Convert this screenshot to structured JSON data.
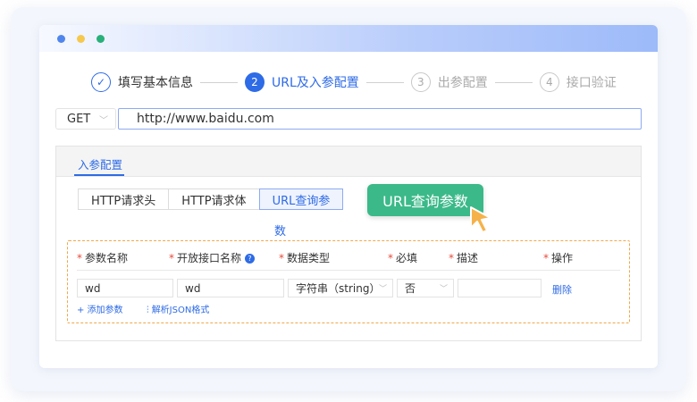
{
  "steps": [
    {
      "num": "✓",
      "label": "填写基本信息",
      "state": "done"
    },
    {
      "num": "2",
      "label": "URL及入参配置",
      "state": "active"
    },
    {
      "num": "3",
      "label": "出参配置",
      "state": "pending"
    },
    {
      "num": "4",
      "label": "接口验证",
      "state": "pending"
    }
  ],
  "request": {
    "method": "GET",
    "url": "http://www.baidu.com"
  },
  "panel": {
    "tab": "入参配置",
    "subtabs": [
      "HTTP请求头",
      "HTTP请求体",
      "URL查询参"
    ],
    "subtab_wrap": "数",
    "callout": "URL查询参数"
  },
  "table": {
    "headers": {
      "param_name": "参数名称",
      "open_name": "开放接口名称",
      "data_type": "数据类型",
      "required": "必填",
      "description": "描述",
      "operation": "操作"
    },
    "row": {
      "param_name": "wd",
      "open_name": "wd",
      "data_type": "字符串（string）",
      "required": "否",
      "description": "",
      "delete": "删除"
    },
    "add_param": "+ 添加参数",
    "parse_json": "解析JSON格式"
  },
  "colors": {
    "primary": "#2e6be6",
    "callout": "#3bb989",
    "dashed": "#f0a84a",
    "required": "#e74c3c"
  }
}
